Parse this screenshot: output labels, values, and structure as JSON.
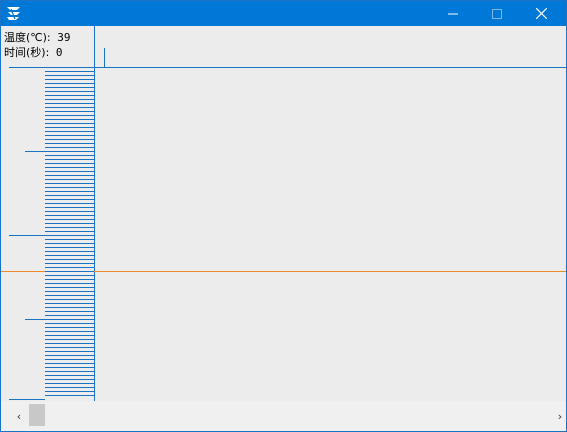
{
  "window": {
    "minimize_glyph": "—",
    "close_glyph": "✕"
  },
  "readouts": {
    "temperature_label": "温度(℃):",
    "temperature_value": "39",
    "time_label": "时间(秒):",
    "time_value": "0"
  },
  "scrollbar": {
    "left_arrow": "‹",
    "right_arrow": "›"
  },
  "colors": {
    "titlebar": "#0078d7",
    "plot_line": "#1a73c6",
    "setpoint_line": "#f08c28",
    "background": "#ececec"
  },
  "icons": {
    "app": "app-logo-icon",
    "minimize": "minimize-icon",
    "maximize": "maximize-icon",
    "close": "close-icon"
  }
}
